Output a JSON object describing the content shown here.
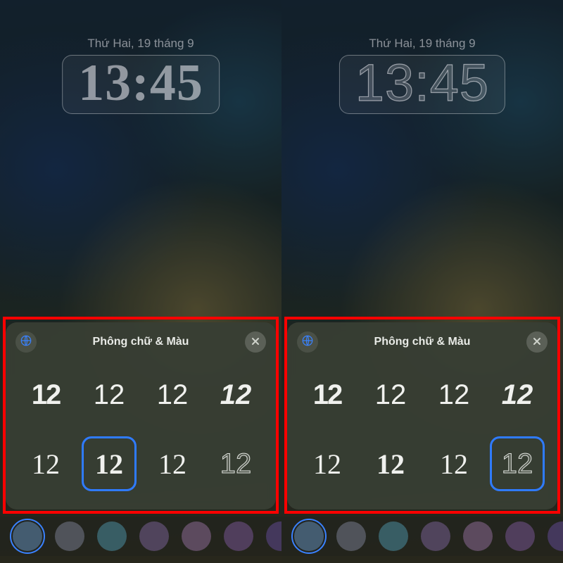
{
  "date_text": "Thứ Hai, 19 tháng 9",
  "time_text": "13:45",
  "sheet": {
    "title": "Phông chữ & Màu",
    "sample": "12"
  },
  "left_selected_index": 5,
  "right_selected_index": 7,
  "colors": [
    "#5a7a96",
    "#6a6f78",
    "#4a7c86",
    "#6a5a7a",
    "#7a627e",
    "#6a527a",
    "#5a4a7a"
  ],
  "selected_color_index": 0
}
